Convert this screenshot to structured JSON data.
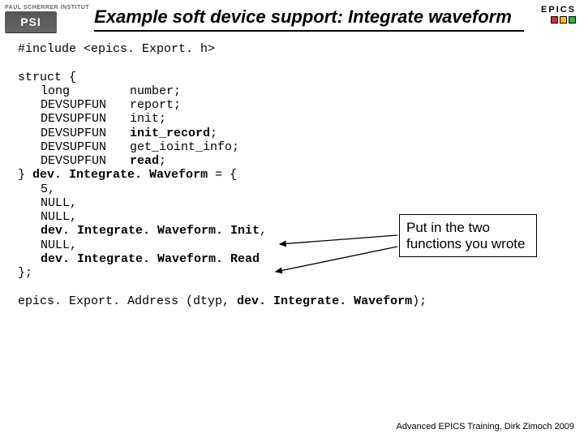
{
  "logo": {
    "institute": "PAUL SCHERRER INSTITUT",
    "mark": "PSI"
  },
  "title": "Example soft device support: Integrate waveform",
  "epics": {
    "label": "EPICS"
  },
  "code": {
    "include": "#include <epics. Export. h>",
    "struct_open": "struct {",
    "rows": [
      {
        "t": "long",
        "n": "number;"
      },
      {
        "t": "DEVSUPFUN",
        "n": "report;"
      },
      {
        "t": "DEVSUPFUN",
        "n": "init;"
      },
      {
        "t": "DEVSUPFUN",
        "n": "init_record",
        "b": true,
        "sc": ";"
      },
      {
        "t": "DEVSUPFUN",
        "n": "get_ioint_info;"
      },
      {
        "t": "DEVSUPFUN",
        "n": "read",
        "b": true,
        "sc": ";"
      }
    ],
    "close_brace": "}",
    "struct_name": "dev. Integrate. Waveform",
    "struct_eq": " = {",
    "five": "5,",
    "null": "NULL,",
    "init_fn": "dev. Integrate. Waveform. Init",
    "read_fn": "dev. Integrate. Waveform. Read",
    "struct_end": "};",
    "export_pre": "epics. Export. Address (dtyp, ",
    "export_name": "dev. Integrate. Waveform",
    "export_post": ");"
  },
  "callout": "Put in the two functions you wrote",
  "footer": "Advanced EPICS Training, Dirk Zimoch 2009"
}
